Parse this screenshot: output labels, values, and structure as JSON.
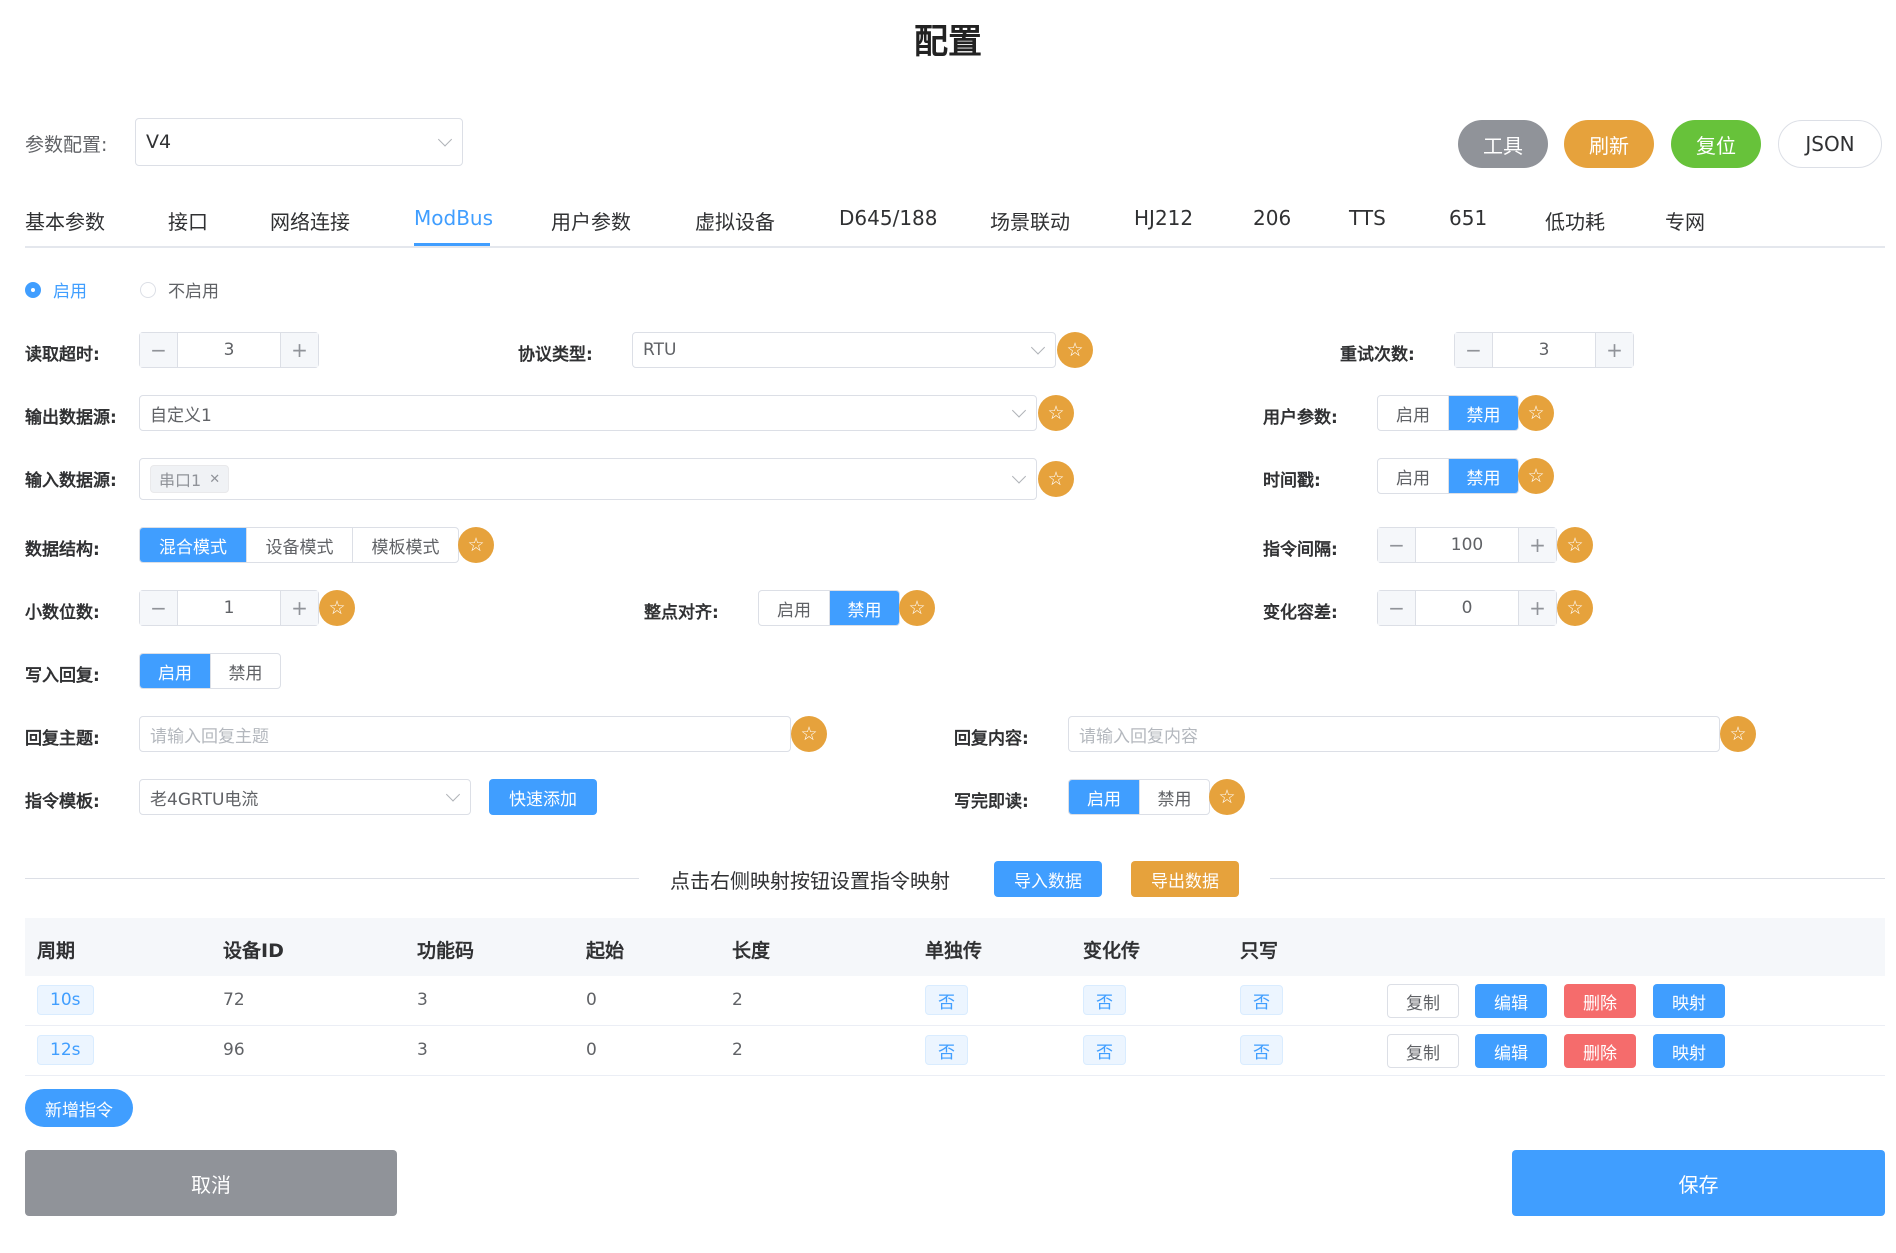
{
  "page": {
    "title": "配置"
  },
  "toolbar": {
    "param_label": "参数配置:",
    "param_value": "V4",
    "tools": "工具",
    "refresh": "刷新",
    "reset": "复位",
    "json": "JSON"
  },
  "tabs": [
    "基本参数",
    "接口",
    "网络连接",
    "ModBus",
    "用户参数",
    "虚拟设备",
    "D645/188",
    "场景联动",
    "HJ212",
    "206",
    "TTS",
    "651",
    "低功耗",
    "专网"
  ],
  "active_tab": "ModBus",
  "enable": {
    "on": "启用",
    "off": "不启用",
    "selected": "启用"
  },
  "form": {
    "read_timeout": {
      "label": "读取超时:",
      "value": "3"
    },
    "protocol": {
      "label": "协议类型:",
      "value": "RTU"
    },
    "retry": {
      "label": "重试次数:",
      "value": "3"
    },
    "output_source": {
      "label": "输出数据源:",
      "value": "自定义1"
    },
    "user_params": {
      "label": "用户参数:",
      "on": "启用",
      "off": "禁用",
      "selected": "禁用"
    },
    "input_source": {
      "label": "输入数据源:",
      "tag": "串口1"
    },
    "timestamp": {
      "label": "时间戳:",
      "on": "启用",
      "off": "禁用",
      "selected": "禁用"
    },
    "data_struct": {
      "label": "数据结构:",
      "options": [
        "混合模式",
        "设备模式",
        "模板模式"
      ],
      "selected": "混合模式"
    },
    "cmd_interval": {
      "label": "指令间隔:",
      "value": "100"
    },
    "decimals": {
      "label": "小数位数:",
      "value": "1"
    },
    "align": {
      "label": "整点对齐:",
      "on": "启用",
      "off": "禁用",
      "selected": "禁用"
    },
    "tolerance": {
      "label": "变化容差:",
      "value": "0"
    },
    "write_reply": {
      "label": "写入回复:",
      "on": "启用",
      "off": "禁用",
      "selected": "启用"
    },
    "reply_topic": {
      "label": "回复主题:",
      "placeholder": "请输入回复主题"
    },
    "reply_content": {
      "label": "回复内容:",
      "placeholder": "请输入回复内容"
    },
    "cmd_template": {
      "label": "指令模板:",
      "value": "老4GRTU电流",
      "quick_add": "快速添加"
    },
    "write_read": {
      "label": "写完即读:",
      "on": "启用",
      "off": "禁用",
      "selected": "启用"
    }
  },
  "mapping": {
    "hint": "点击右侧映射按钮设置指令映射",
    "import": "导入数据",
    "export": "导出数据"
  },
  "table": {
    "headers": [
      "周期",
      "设备ID",
      "功能码",
      "起始",
      "长度",
      "单独传",
      "变化传",
      "只写"
    ],
    "rows": [
      {
        "period": "10s",
        "device_id": "72",
        "func": "3",
        "start": "0",
        "length": "2",
        "single": "否",
        "change": "否",
        "write_only": "否"
      },
      {
        "period": "12s",
        "device_id": "96",
        "func": "3",
        "start": "0",
        "length": "2",
        "single": "否",
        "change": "否",
        "write_only": "否"
      }
    ],
    "actions": {
      "copy": "复制",
      "edit": "编辑",
      "delete": "删除",
      "map": "映射"
    },
    "add": "新增指令"
  },
  "footer": {
    "cancel": "取消",
    "save": "保存"
  },
  "colors": {
    "primary": "#409eff",
    "warning": "#e6a23c",
    "success": "#67c23a",
    "danger": "#f56c6c",
    "info": "#909399"
  },
  "icons": {
    "star": "star-icon",
    "chevron": "chevron-down-icon",
    "close": "close-icon",
    "plus": "plus-icon",
    "minus": "minus-icon"
  }
}
